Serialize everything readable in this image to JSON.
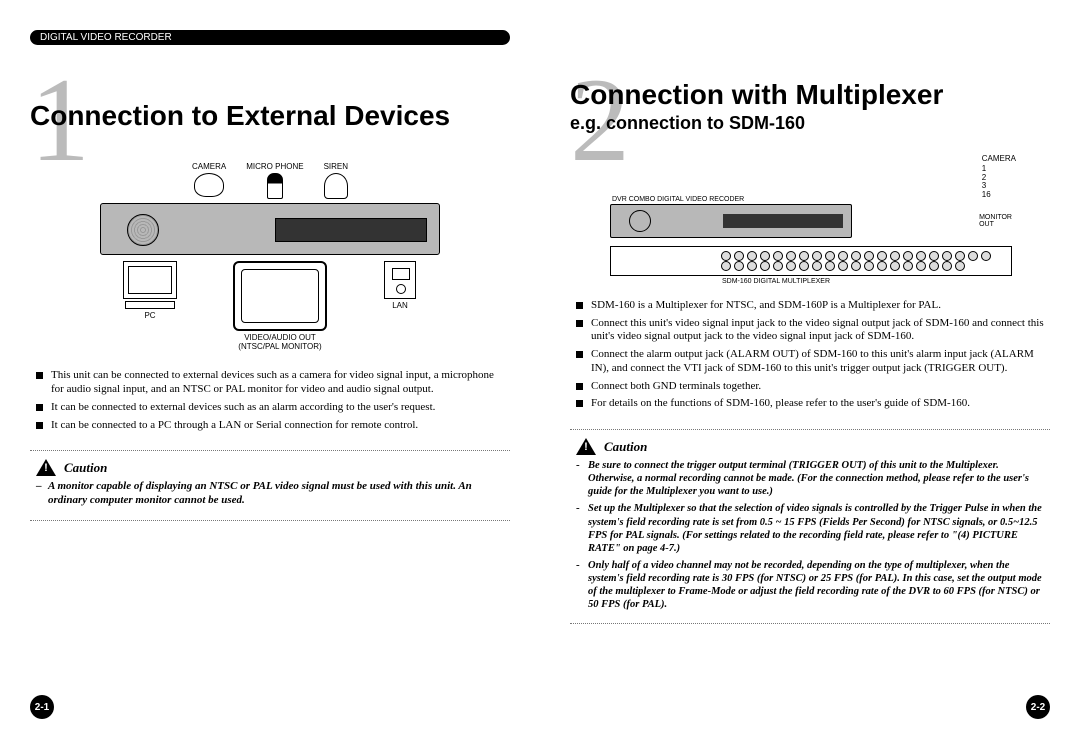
{
  "header_pill": "DIGITAL VIDEO RECORDER",
  "section1": {
    "number": "1",
    "title": "Connection to External Devices",
    "labels": {
      "camera": "CAMERA",
      "microphone": "MICRO PHONE",
      "siren": "SIREN",
      "pc": "PC",
      "video_audio_out": "VIDEO/AUDIO OUT",
      "monitor_type": "(NTSC/PAL MONITOR)",
      "lan": "LAN"
    },
    "bullets": [
      "This unit can be connected to external devices such as a camera for video signal input, a microphone for audio signal input, and an NTSC or PAL  monitor for video and audio signal output.",
      "It can be connected to external devices such as an alarm according to the user's request.",
      "It can be connected to a PC through a LAN or Serial connection for remote control."
    ],
    "caution_label": "Caution",
    "cautions": [
      "A monitor capable of displaying an NTSC or PAL video signal must be used with this unit. An ordinary computer monitor cannot be used."
    ],
    "page_number": "2-1"
  },
  "section2": {
    "number": "2",
    "title": "Connection with Multiplexer",
    "subtitle": "e.g. connection to SDM-160",
    "labels": {
      "camera": "CAMERA",
      "cam_nums": [
        "1",
        "2",
        "3",
        "16"
      ],
      "dvr": "DVR COMBO DIGITAL VIDEO RECODER",
      "monitor_out": "MONITOR",
      "monitor_out2": "OUT",
      "mux": "SDM-160 DIGITAL MULTIPLEXER"
    },
    "bullets": [
      "SDM-160 is a Multiplexer for NTSC, and SDM-160P is a Multiplexer for PAL.",
      "Connect this unit's video signal input jack to the video signal output jack of SDM-160 and connect this unit's video signal output jack to the video signal input jack of SDM-160.",
      "Connect the alarm output jack (ALARM OUT) of SDM-160 to this unit's alarm input jack (ALARM IN), and connect the VTI jack of SDM-160 to this unit's trigger output jack (TRIGGER OUT).",
      "Connect both GND terminals together.",
      "For details on the functions of SDM-160, please refer to the user's guide of SDM-160."
    ],
    "caution_label": "Caution",
    "cautions": [
      "Be sure to connect the trigger output terminal (TRIGGER OUT) of this unit to the Multiplexer. Otherwise, a normal recording cannot be made. (For the connection method, please refer to the user's guide for the Multiplexer you want to use.)",
      "Set up the Multiplexer so that the selection of video signals is controlled by the Trigger Pulse in when the system's field recording rate is set from 0.5 ~ 15 FPS (Fields Per Second) for NTSC signals, or 0.5~12.5 FPS for PAL signals. (For settings related to the recording field rate, please refer to \"(4) PICTURE RATE\" on page 4-7.)",
      "Only half of a video channel may not be recorded, depending on the type of multiplexer, when the system's field recording rate is 30 FPS (for NTSC) or 25 FPS (for PAL). In this case, set the output mode of the multiplexer to Frame-Mode or adjust the field recording rate of the DVR to 60 FPS (for NTSC) or 50 FPS (for PAL)."
    ],
    "page_number": "2-2"
  }
}
